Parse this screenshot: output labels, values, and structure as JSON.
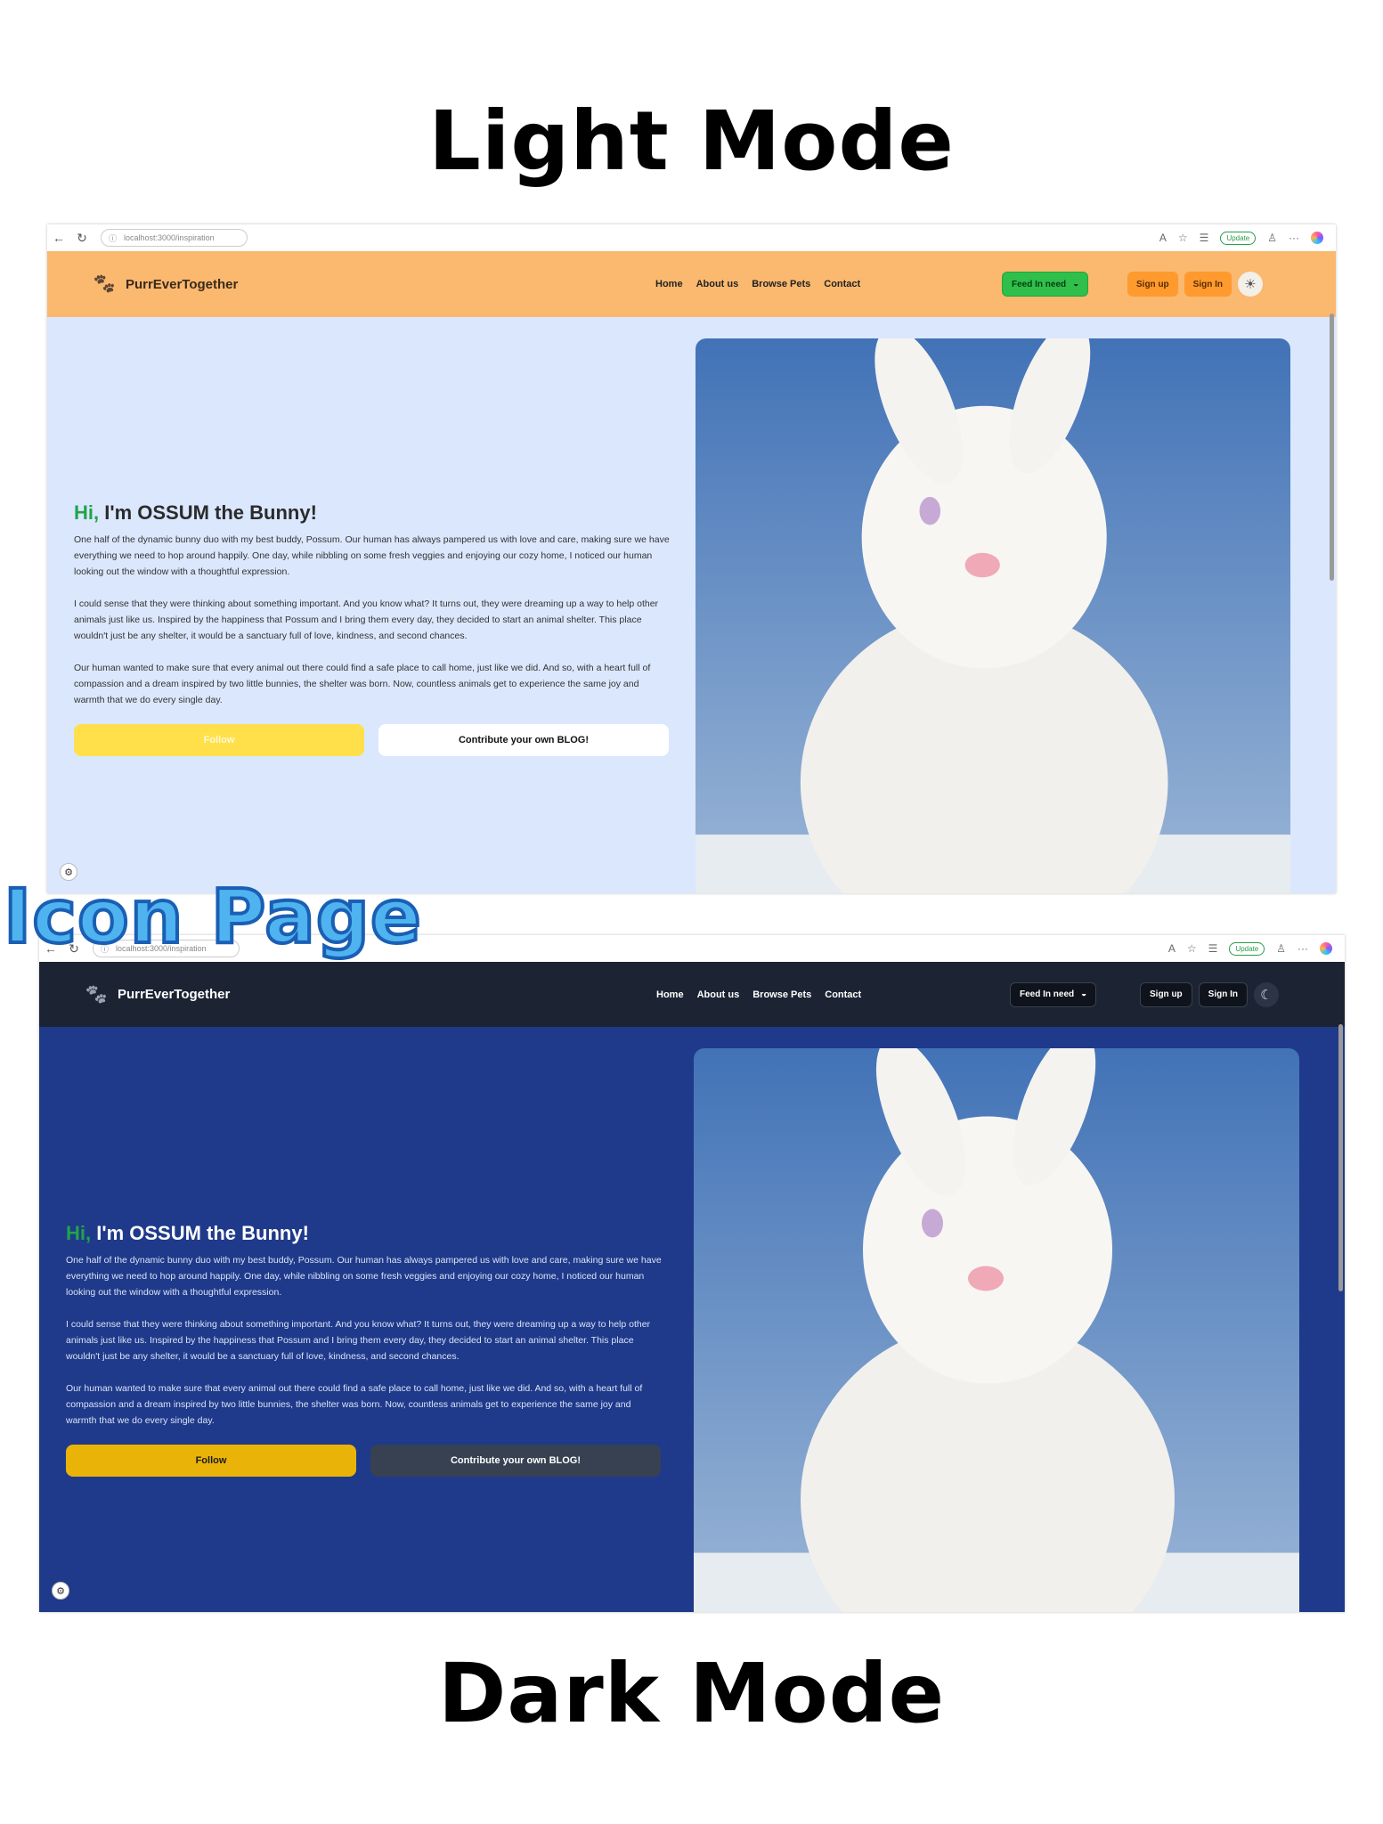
{
  "labels": {
    "light_mode": "Light Mode",
    "icon_page": "Icon Page",
    "dark_mode": "Dark Mode"
  },
  "browser": {
    "url": "localhost:3000/inspiration",
    "update_label": "Update"
  },
  "site": {
    "brand": "PurrEverTogether",
    "nav_links": [
      "Home",
      "About us",
      "Browse Pets",
      "Contact"
    ],
    "feed_button": "Feed In need",
    "sign_up": "Sign up",
    "sign_in": "Sign In"
  },
  "hero": {
    "greeting": "Hi,",
    "title_rest": " I'm OSSUM the Bunny!",
    "paragraphs": [
      "One half of the dynamic bunny duo with my best buddy, Possum. Our human has always pampered us with love and care, making sure we have everything we need to hop around happily. One day, while nibbling on some fresh veggies and enjoying our cozy home, I noticed our human looking out the window with a thoughtful expression.",
      "I could sense that they were thinking about something important. And you know what? It turns out, they were dreaming up a way to help other animals just like us. Inspired by the happiness that Possum and I bring them every day, they decided to start an animal shelter. This place wouldn't just be any shelter, it would be a sanctuary full of love, kindness, and second chances.",
      "Our human wanted to make sure that every animal out there could find a safe place to call home, just like we did. And so, with a heart full of compassion and a dream inspired by two little bunnies, the shelter was born. Now, countless animals get to experience the same joy and warmth that we do every single day."
    ],
    "follow_button": "Follow",
    "contribute_button": "Contribute your own BLOG!"
  },
  "colors": {
    "light_navbar": "#fbb86f",
    "light_background": "#dbe7fd",
    "dark_navbar": "#1c2333",
    "dark_background": "#1f3a8a",
    "accent_green": "#22a34a",
    "follow_yellow": "#eab308"
  },
  "icons": [
    "back-arrow-icon",
    "refresh-icon",
    "info-icon",
    "paw-icon",
    "bowl-icon",
    "sun-icon",
    "moon-icon",
    "star-icon",
    "favorites-icon",
    "profile-icon",
    "more-icon",
    "copilot-icon"
  ]
}
